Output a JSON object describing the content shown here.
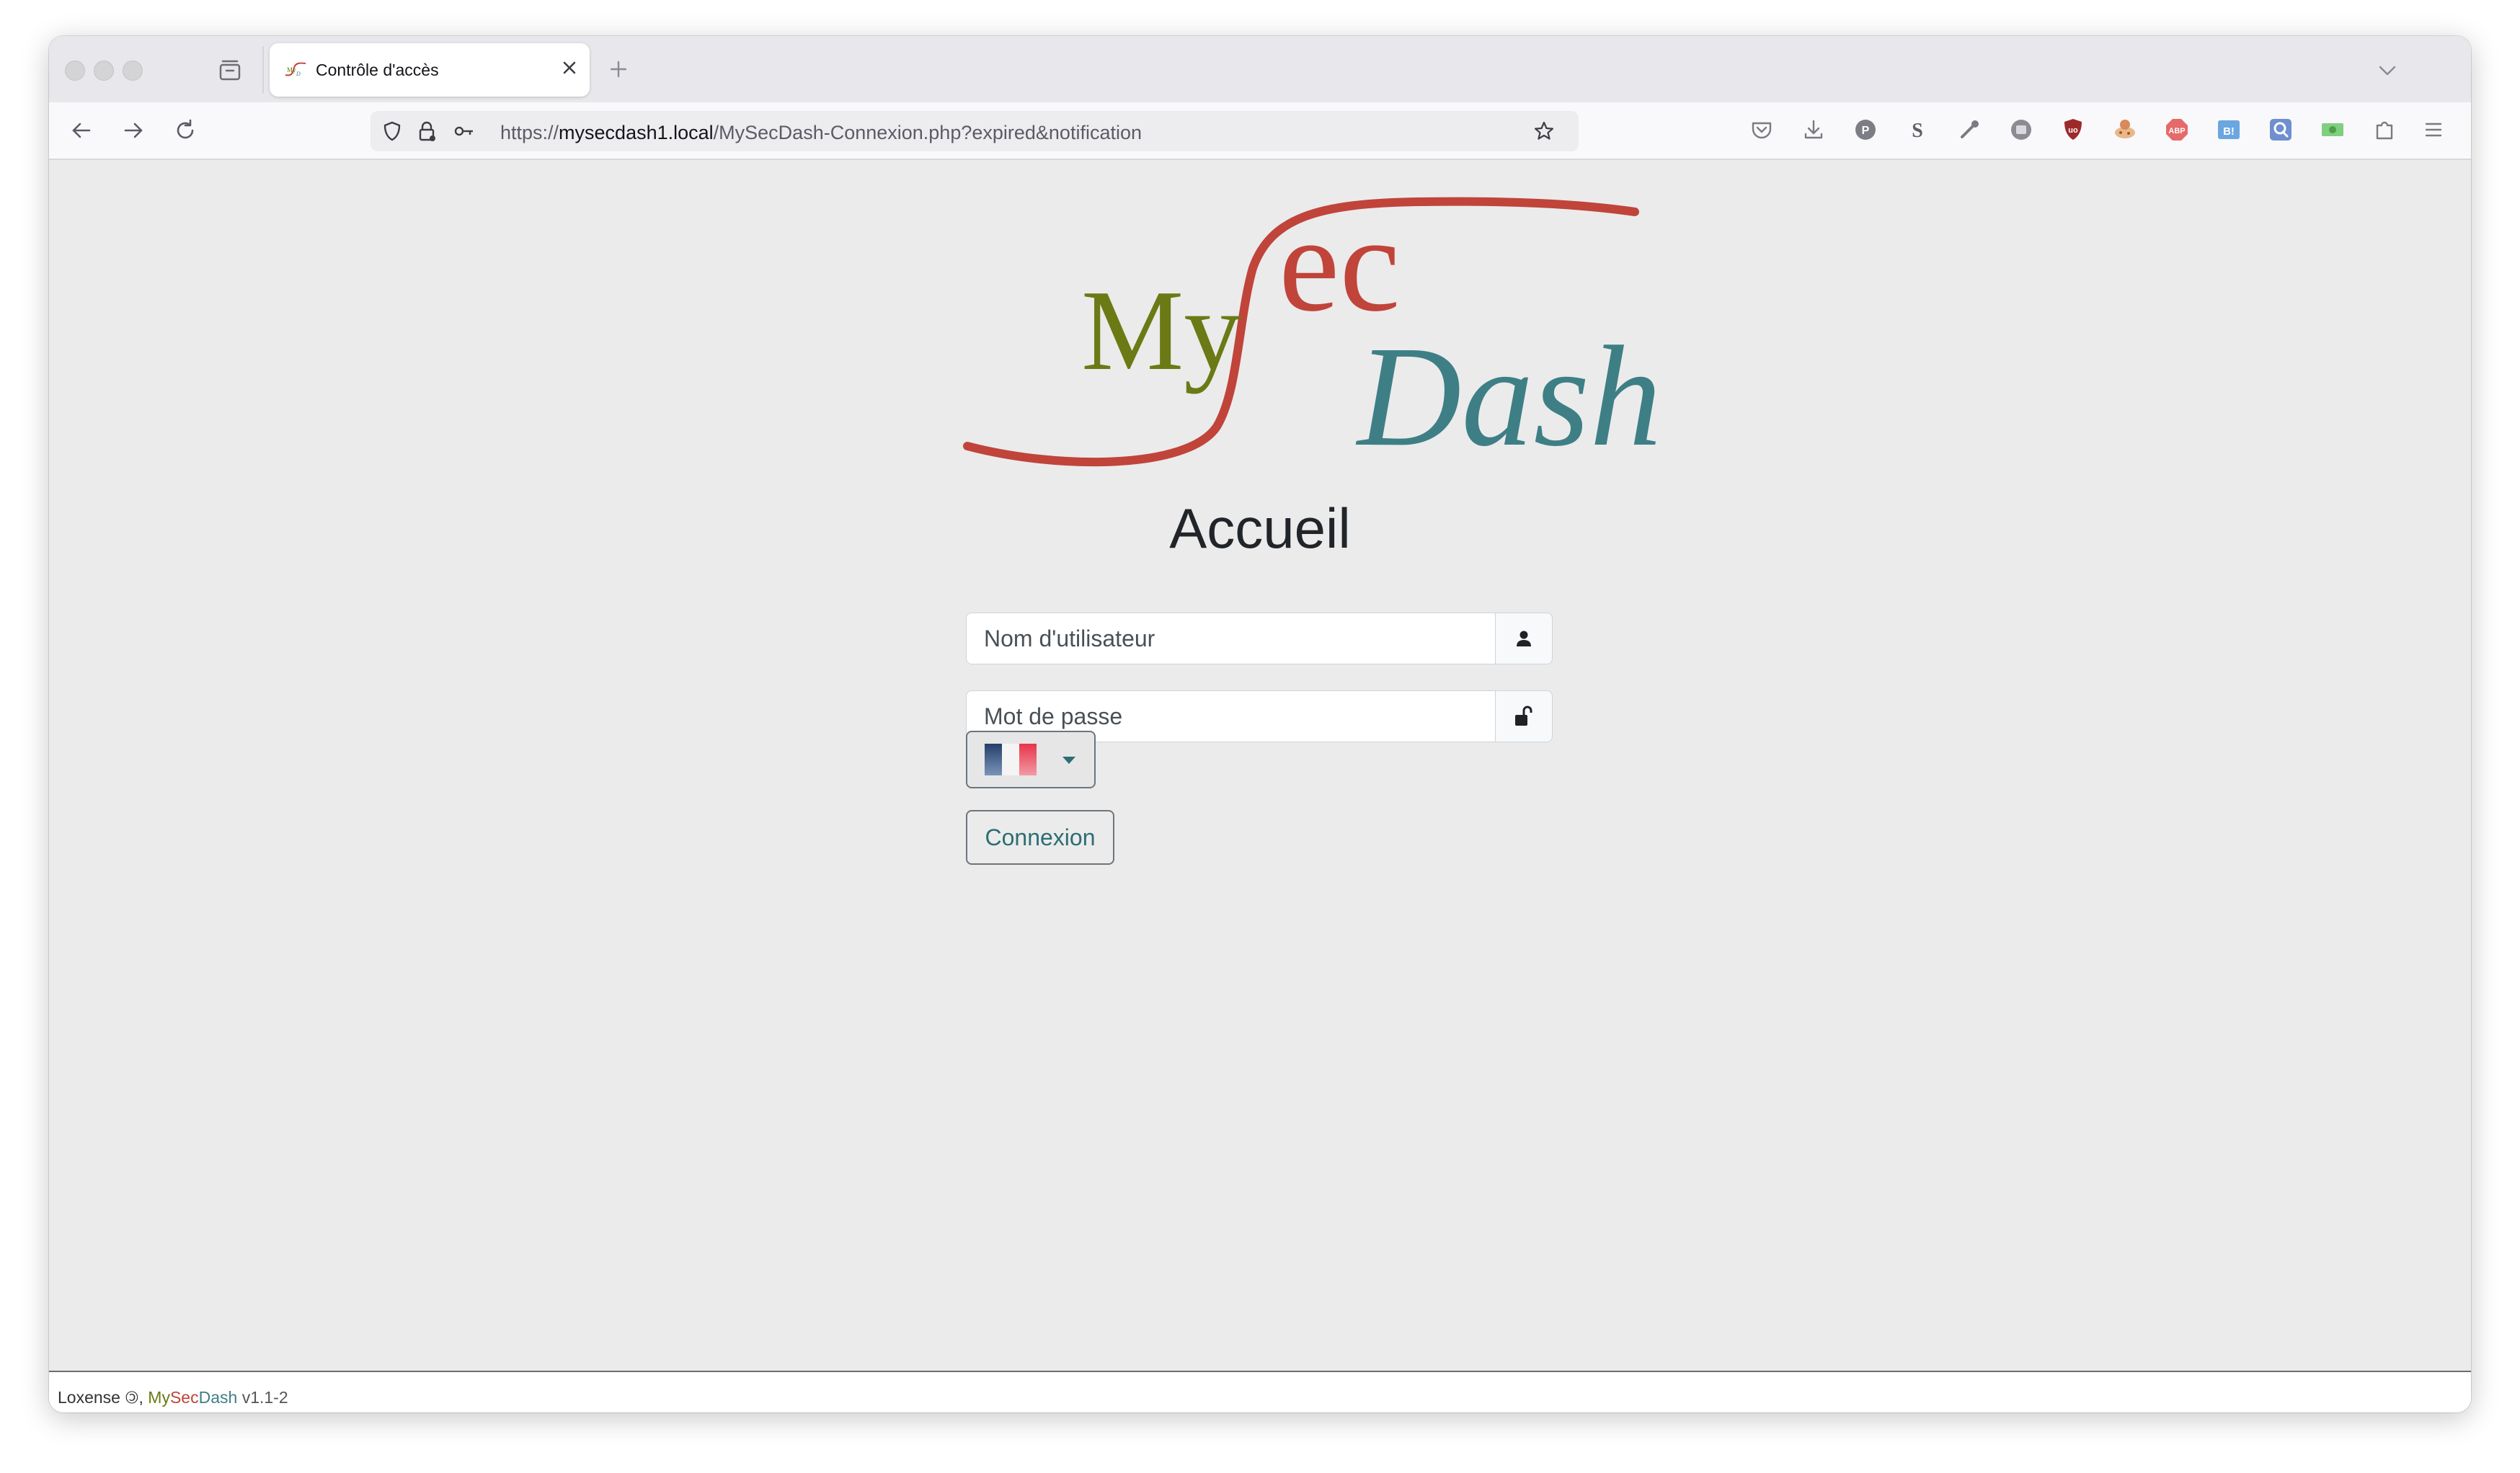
{
  "browser": {
    "tab": {
      "title": "Contrôle d'accès",
      "favicon": "mysecdash-favicon-icon"
    },
    "url": {
      "prefix": "https://",
      "host": "mysecdash1.local",
      "path": "/MySecDash-Connexion.php?expired&notification"
    },
    "toolbar_icons": [
      "back-icon",
      "forward-icon",
      "reload-icon",
      "shield-icon",
      "lock-icon",
      "key-icon",
      "star-icon",
      "pocket-icon",
      "download-icon",
      "p-extension-icon",
      "s-extension-icon",
      "eyedropper-icon",
      "gray-extension-icon",
      "ublock-icon",
      "cookie-icon",
      "abp-icon",
      "bookmark-b-icon",
      "q-extension-icon",
      "money-icon",
      "extensions-icon",
      "menu-icon"
    ]
  },
  "logo": {
    "my": "My",
    "ec": "ec",
    "dash": "Dash",
    "colors": {
      "my": "#6b7a14",
      "sec": "#c0443a",
      "dash": "#3e7f86"
    }
  },
  "page": {
    "heading": "Accueil",
    "username_placeholder": "Nom d'utilisateur",
    "password_placeholder": "Mot de passe",
    "language_selected": "fr",
    "login_label": "Connexion"
  },
  "footer": {
    "company": "Loxense",
    "copyleft_symbol": "🄯",
    "separator": ",",
    "product_my": "My",
    "product_sec": "Sec",
    "product_dash": "Dash",
    "version": "v1.1-2"
  }
}
